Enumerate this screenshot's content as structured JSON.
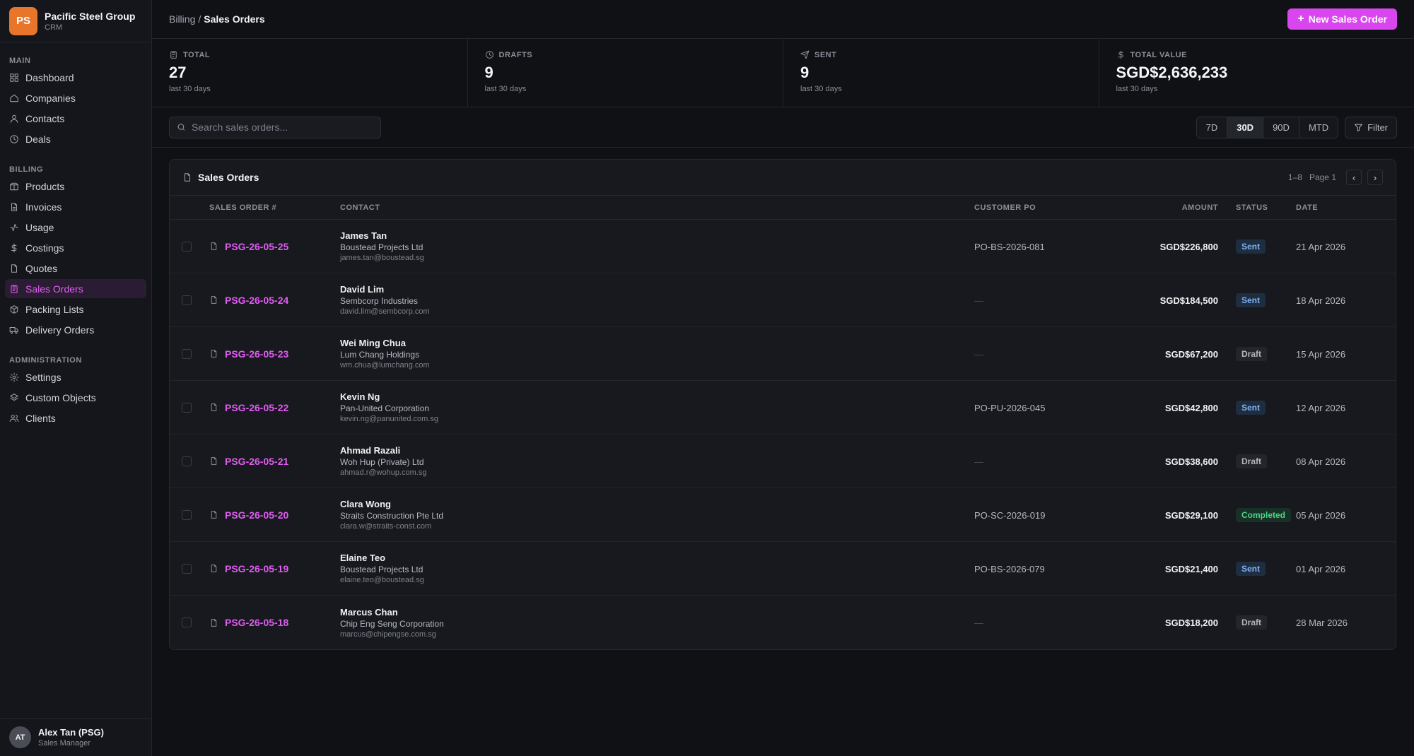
{
  "brand": {
    "initials": "PS",
    "name": "Pacific Steel Group",
    "subtitle": "CRM",
    "logo_color": "#e8762a"
  },
  "sidebar": {
    "sections": [
      {
        "heading": "MAIN",
        "items": [
          {
            "label": "Dashboard",
            "icon": "grid-icon"
          },
          {
            "label": "Companies",
            "icon": "home-icon"
          },
          {
            "label": "Contacts",
            "icon": "user-icon"
          },
          {
            "label": "Deals",
            "icon": "clock-icon"
          }
        ]
      },
      {
        "heading": "BILLING",
        "items": [
          {
            "label": "Products",
            "icon": "box-icon"
          },
          {
            "label": "Invoices",
            "icon": "file-icon"
          },
          {
            "label": "Usage",
            "icon": "activity-icon"
          },
          {
            "label": "Costings",
            "icon": "dollar-icon"
          },
          {
            "label": "Quotes",
            "icon": "document-icon"
          },
          {
            "label": "Sales Orders",
            "icon": "clipboard-icon",
            "active": true
          },
          {
            "label": "Packing Lists",
            "icon": "package-icon"
          },
          {
            "label": "Delivery Orders",
            "icon": "truck-icon"
          }
        ]
      },
      {
        "heading": "ADMINISTRATION",
        "items": [
          {
            "label": "Settings",
            "icon": "gear-icon"
          },
          {
            "label": "Custom Objects",
            "icon": "layers-icon"
          },
          {
            "label": "Clients",
            "icon": "users-icon"
          }
        ]
      }
    ]
  },
  "user": {
    "initials": "AT",
    "name": "Alex Tan (PSG)",
    "role": "Sales Manager"
  },
  "header": {
    "breadcrumb_parent": "Billing",
    "breadcrumb_sep": "/",
    "breadcrumb_current": "Sales Orders",
    "new_button": "New Sales Order",
    "accent": "#d946ef"
  },
  "stats": [
    {
      "label": "TOTAL",
      "value": "27",
      "sub": "last 30 days",
      "icon": "clipboard-icon"
    },
    {
      "label": "DRAFTS",
      "value": "9",
      "sub": "last 30 days",
      "icon": "clock-icon"
    },
    {
      "label": "SENT",
      "value": "9",
      "sub": "last 30 days",
      "icon": "send-icon"
    },
    {
      "label": "TOTAL VALUE",
      "value": "SGD$2,636,233",
      "sub": "last 30 days",
      "icon": "dollar-icon"
    }
  ],
  "toolbar": {
    "search_placeholder": "Search sales orders...",
    "ranges": [
      "7D",
      "30D",
      "90D",
      "MTD"
    ],
    "active_range": "30D",
    "filter_label": "Filter"
  },
  "table": {
    "title": "Sales Orders",
    "range_text": "1–8",
    "page_text": "Page 1",
    "columns": {
      "order": "SALES ORDER #",
      "contact": "CONTACT",
      "po": "CUSTOMER PO",
      "amount": "AMOUNT",
      "status": "STATUS",
      "date": "DATE"
    },
    "rows": [
      {
        "order": "PSG-26-05-25",
        "name": "James Tan",
        "company": "Boustead Projects Ltd",
        "email": "james.tan@boustead.sg",
        "po": "PO-BS-2026-081",
        "amount": "SGD$226,800",
        "status": "Sent",
        "date": "21 Apr 2026"
      },
      {
        "order": "PSG-26-05-24",
        "name": "David Lim",
        "company": "Sembcorp Industries",
        "email": "david.lim@sembcorp.com",
        "po": "—",
        "amount": "SGD$184,500",
        "status": "Sent",
        "date": "18 Apr 2026"
      },
      {
        "order": "PSG-26-05-23",
        "name": "Wei Ming Chua",
        "company": "Lum Chang Holdings",
        "email": "wm.chua@lumchang.com",
        "po": "—",
        "amount": "SGD$67,200",
        "status": "Draft",
        "date": "15 Apr 2026"
      },
      {
        "order": "PSG-26-05-22",
        "name": "Kevin Ng",
        "company": "Pan-United Corporation",
        "email": "kevin.ng@panunited.com.sg",
        "po": "PO-PU-2026-045",
        "amount": "SGD$42,800",
        "status": "Sent",
        "date": "12 Apr 2026"
      },
      {
        "order": "PSG-26-05-21",
        "name": "Ahmad Razali",
        "company": "Woh Hup (Private) Ltd",
        "email": "ahmad.r@wohup.com.sg",
        "po": "—",
        "amount": "SGD$38,600",
        "status": "Draft",
        "date": "08 Apr 2026"
      },
      {
        "order": "PSG-26-05-20",
        "name": "Clara Wong",
        "company": "Straits Construction Pte Ltd",
        "email": "clara.w@straits-const.com",
        "po": "PO-SC-2026-019",
        "amount": "SGD$29,100",
        "status": "Completed",
        "date": "05 Apr 2026"
      },
      {
        "order": "PSG-26-05-19",
        "name": "Elaine Teo",
        "company": "Boustead Projects Ltd",
        "email": "elaine.teo@boustead.sg",
        "po": "PO-BS-2026-079",
        "amount": "SGD$21,400",
        "status": "Sent",
        "date": "01 Apr 2026"
      },
      {
        "order": "PSG-26-05-18",
        "name": "Marcus Chan",
        "company": "Chip Eng Seng Corporation",
        "email": "marcus@chipengse.com.sg",
        "po": "—",
        "amount": "SGD$18,200",
        "status": "Draft",
        "date": "28 Mar 2026"
      }
    ]
  }
}
